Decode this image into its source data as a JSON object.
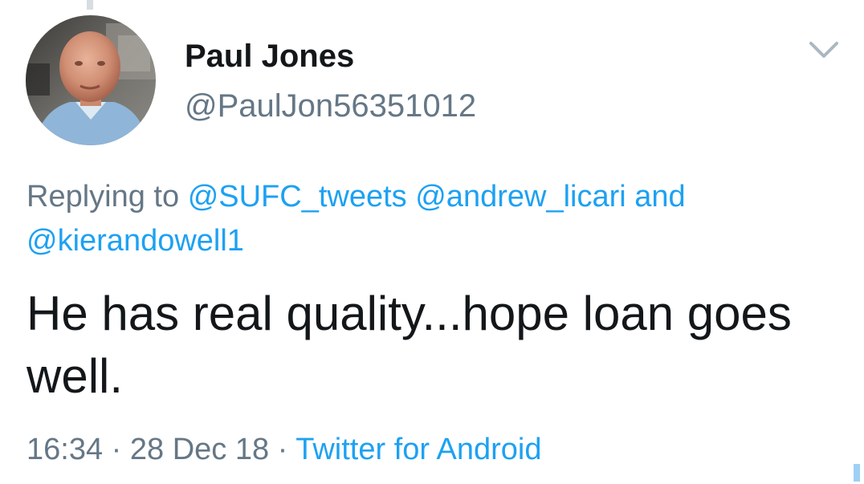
{
  "tweet": {
    "author": {
      "display_name": "Paul Jones",
      "handle": "@PaulJon56351012",
      "avatar_icon": "profile-photo"
    },
    "menu_icon": "chevron-down-icon",
    "reply": {
      "prefix": "Replying to",
      "mentions": [
        "@SUFC_tweets",
        "@andrew_licari",
        "@kierandowell1"
      ],
      "conjunction": "and"
    },
    "text": "He has real quality...hope loan goes well.",
    "meta": {
      "time": "16:34",
      "separator": "·",
      "date": "28 Dec 18",
      "source": "Twitter for Android"
    }
  },
  "colors": {
    "text_primary": "#14171a",
    "text_secondary": "#657786",
    "link": "#1da1f2",
    "background": "#ffffff"
  }
}
